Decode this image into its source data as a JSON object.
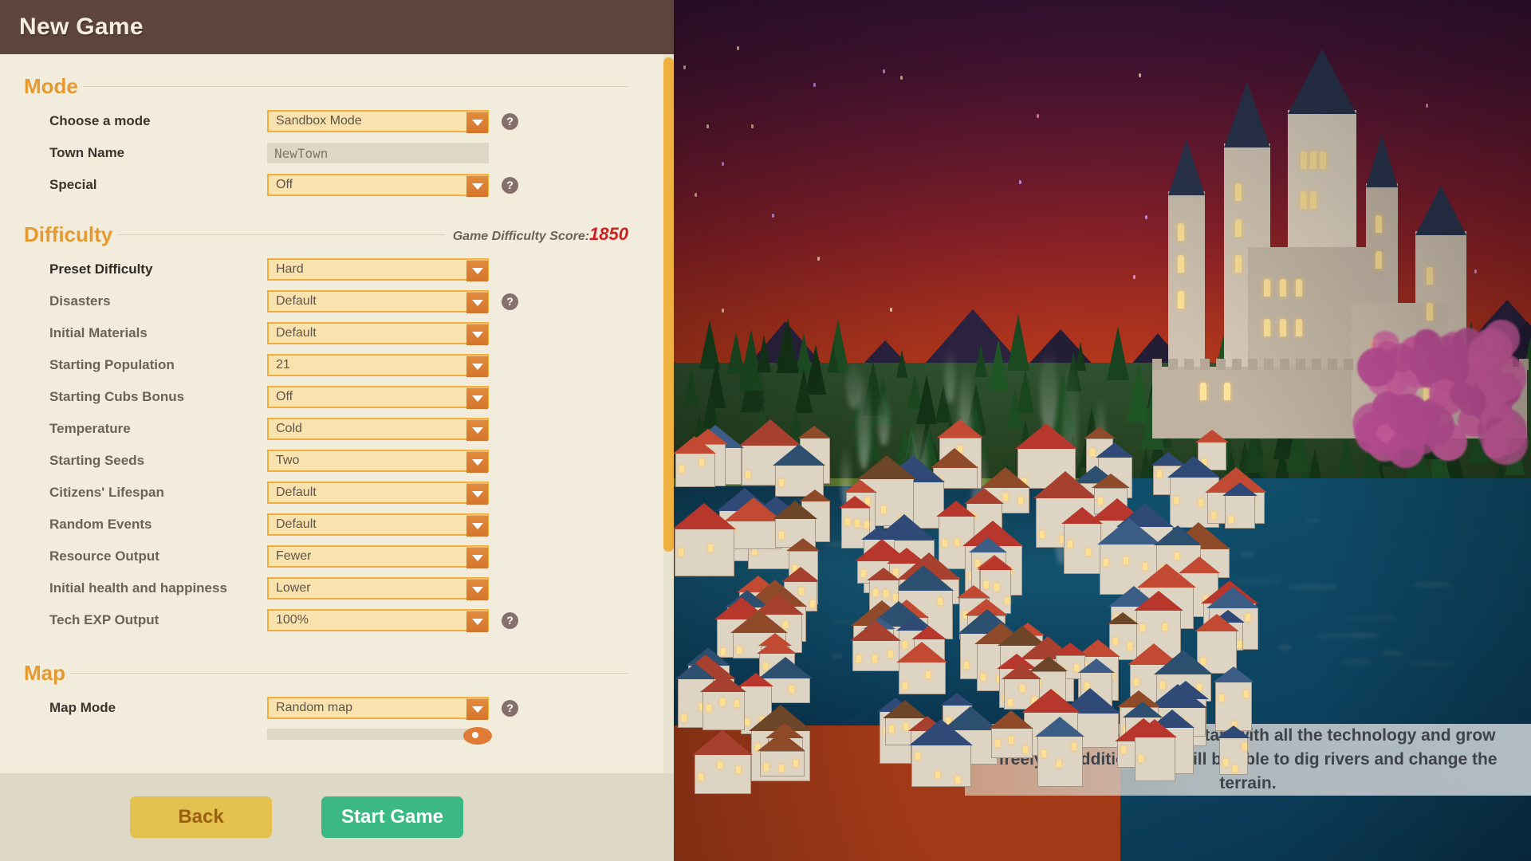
{
  "window": {
    "title": "New Game"
  },
  "sections": {
    "mode": {
      "title": "Mode",
      "rows": [
        {
          "label": "Choose a mode",
          "value": "Sandbox Mode",
          "control": "select",
          "help": true
        },
        {
          "label": "Town Name",
          "value": "NewTown",
          "control": "text",
          "help": false
        },
        {
          "label": "Special",
          "value": "Off",
          "control": "select",
          "help": true
        }
      ]
    },
    "difficulty": {
      "title": "Difficulty",
      "score_label": "Game Difficulty Score:",
      "score_value": "1850",
      "rows": [
        {
          "label": "Preset Difficulty",
          "value": "Hard",
          "control": "select",
          "help": false
        },
        {
          "label": "Disasters",
          "value": "Default",
          "control": "select",
          "help": true
        },
        {
          "label": "Initial Materials",
          "value": "Default",
          "control": "select",
          "help": false
        },
        {
          "label": "Starting Population",
          "value": "21",
          "control": "select",
          "help": false
        },
        {
          "label": "Starting Cubs Bonus",
          "value": "Off",
          "control": "select",
          "help": false
        },
        {
          "label": "Temperature",
          "value": "Cold",
          "control": "select",
          "help": false
        },
        {
          "label": "Starting Seeds",
          "value": "Two",
          "control": "select",
          "help": false
        },
        {
          "label": "Citizens' Lifespan",
          "value": "Default",
          "control": "select",
          "help": false
        },
        {
          "label": "Random Events",
          "value": "Default",
          "control": "select",
          "help": false
        },
        {
          "label": "Resource Output",
          "value": "Fewer",
          "control": "select",
          "help": false
        },
        {
          "label": "Initial health and happiness",
          "value": "Lower",
          "control": "select",
          "help": false
        },
        {
          "label": "Tech EXP Output",
          "value": "100%",
          "control": "select",
          "help": true
        }
      ]
    },
    "map": {
      "title": "Map",
      "rows": [
        {
          "label": "Map Mode",
          "value": "Random map",
          "control": "select",
          "help": true
        }
      ]
    }
  },
  "footer": {
    "back_label": "Back",
    "start_label": "Start Game"
  },
  "tooltip": {
    "text": "In sandbox mode, you'll start with all the technology and grow freely. In addition, you will be able to dig rivers and change the terrain."
  },
  "icons": {
    "help": "?",
    "dropdown": "chevron-down-icon"
  },
  "colors": {
    "titlebar": "#5d453d",
    "panel": "#f2ecdc",
    "accent_orange": "#e59a30",
    "select_fill": "#fae2ae",
    "select_border": "#f0ae3c",
    "arrow_button": "#d5752c",
    "score_red": "#cc1f21",
    "back_button": "#e4c04e",
    "start_button": "#3bb883",
    "scrollbar": "#eeb13f",
    "footer": "#ded8c6",
    "help_icon": "#86706d"
  }
}
